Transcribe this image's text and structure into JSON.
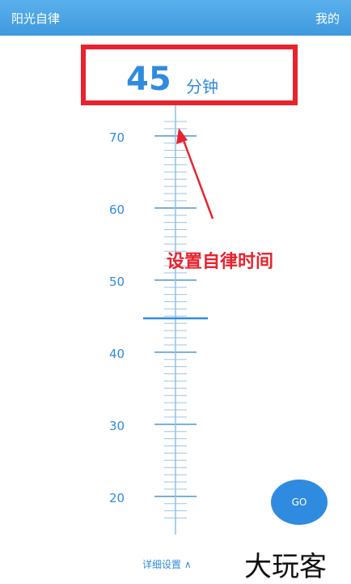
{
  "header": {
    "title": "阳光自律",
    "mine": "我的"
  },
  "timer": {
    "value": "45",
    "unit": "分钟"
  },
  "ruler": {
    "labels": [
      "70",
      "60",
      "50",
      "40",
      "30",
      "20"
    ]
  },
  "annotation": {
    "text": "设置自律时间"
  },
  "go_button": {
    "label": "GO"
  },
  "details": {
    "label": "详细设置 ∧"
  },
  "watermark_text": "大玩客"
}
